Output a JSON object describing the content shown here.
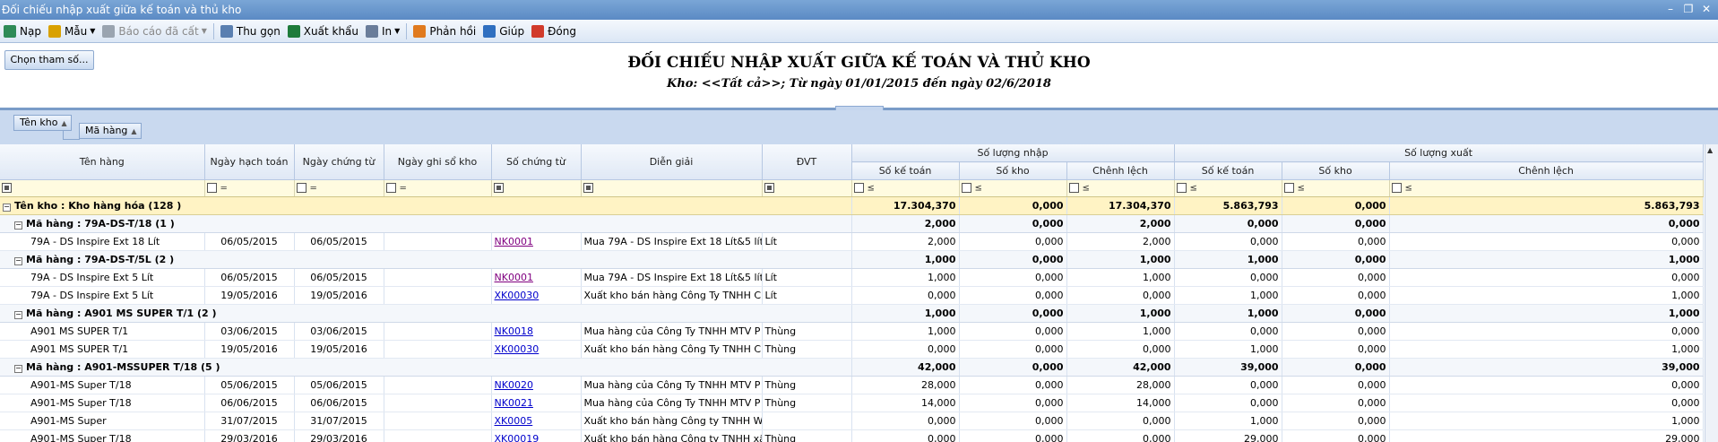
{
  "window": {
    "title": "Đối chiếu nhập xuất giữa kế toán và thủ kho"
  },
  "toolbar": {
    "items": [
      {
        "label": "Nạp",
        "icon": "refresh-icon",
        "color": "#2e8b57"
      },
      {
        "label": "Mẫu",
        "icon": "template-icon",
        "color": "#d9a100",
        "dropdown": true
      },
      {
        "label": "Báo cáo đã cất",
        "icon": "save-icon",
        "color": "#9aa4b0",
        "dropdown": true,
        "disabled": true
      },
      {
        "label": "Thu gọn",
        "icon": "collapse-icon",
        "color": "#5a7fb0"
      },
      {
        "label": "Xuất khẩu",
        "icon": "excel-icon",
        "color": "#1e7b3a"
      },
      {
        "label": "In",
        "icon": "printer-icon",
        "color": "#6a7d9a",
        "dropdown": true
      },
      {
        "label": "Phản hồi",
        "icon": "mail-icon",
        "color": "#e07a1e"
      },
      {
        "label": "Giúp",
        "icon": "help-icon",
        "color": "#2f6fc0"
      },
      {
        "label": "Đóng",
        "icon": "close-icon",
        "color": "#d13b2b"
      }
    ]
  },
  "params": {
    "button_label": "Chọn tham số..."
  },
  "report": {
    "title": "ĐỐI CHIẾU NHẬP XUẤT GIỮA KẾ TOÁN VÀ THỦ KHO",
    "subtitle": "Kho: <<Tất cả>>; Từ ngày 01/01/2015 đến ngày 02/6/2018"
  },
  "grouping": {
    "level1": "Tên kho",
    "level2": "Mã hàng"
  },
  "columns": {
    "ten_hang": "Tên hàng",
    "ngay_hach_toan": "Ngày hạch toán",
    "ngay_chung_tu": "Ngày chứng từ",
    "ngay_ghi_so_kho": "Ngày ghi sổ kho",
    "so_chung_tu": "Số chứng từ",
    "dien_giai": "Diễn giải",
    "dvt": "ĐVT",
    "nhap_band": "Số lượng nhập",
    "xuat_band": "Số lượng xuất",
    "so_ke_toan": "Số kế toán",
    "so_kho": "Số kho",
    "chenh_lech": "Chênh lệch"
  },
  "filter": {
    "eq": "=",
    "le": "≤"
  },
  "group_warehouse": {
    "label": "Tên kho : Kho hàng hóa (128 )",
    "nhap_kt": "17.304,370",
    "nhap_kho": "0,000",
    "nhap_cl": "17.304,370",
    "xuat_kt": "5.863,793",
    "xuat_kho": "0,000",
    "xuat_cl": "5.863,793"
  },
  "groups": [
    {
      "label": "Mã hàng : 79A-DS-T/18 (1 )",
      "nhap_kt": "2,000",
      "nhap_kho": "0,000",
      "nhap_cl": "2,000",
      "xuat_kt": "0,000",
      "xuat_kho": "0,000",
      "xuat_cl": "0,000",
      "rows": [
        {
          "ten": "79A - DS Inspire Ext 18 Lít",
          "nht": "06/05/2015",
          "nct": "06/05/2015",
          "ngsk": "",
          "sct": "NK0001",
          "visited": true,
          "dg": "Mua 79A - DS Inspire Ext 18 Lít&5 lít,",
          "dvt": "Lít",
          "nkt": "2,000",
          "nkho": "0,000",
          "ncl": "2,000",
          "xkt": "0,000",
          "xkho": "0,000",
          "xcl": "0,000"
        }
      ]
    },
    {
      "label": "Mã hàng : 79A-DS-T/5L (2 )",
      "nhap_kt": "1,000",
      "nhap_kho": "0,000",
      "nhap_cl": "1,000",
      "xuat_kt": "1,000",
      "xuat_kho": "0,000",
      "xuat_cl": "1,000",
      "rows": [
        {
          "ten": "79A - DS Inspire Ext 5 Lít",
          "nht": "06/05/2015",
          "nct": "06/05/2015",
          "ngsk": "",
          "sct": "NK0001",
          "visited": true,
          "dg": "Mua 79A - DS Inspire Ext 18 Lít&5 lít,",
          "dvt": "Lít",
          "nkt": "1,000",
          "nkho": "0,000",
          "ncl": "1,000",
          "xkt": "0,000",
          "xkho": "0,000",
          "xcl": "0,000"
        },
        {
          "ten": "79A - DS Inspire Ext 5 Lít",
          "nht": "19/05/2016",
          "nct": "19/05/2016",
          "ngsk": "",
          "sct": "XK00030",
          "visited": false,
          "dg": "Xuất kho bán hàng Công Ty TNHH C",
          "dvt": "Lít",
          "nkt": "0,000",
          "nkho": "0,000",
          "ncl": "0,000",
          "xkt": "1,000",
          "xkho": "0,000",
          "xcl": "1,000"
        }
      ]
    },
    {
      "label": "Mã hàng : A901 MS SUPER T/1 (2 )",
      "nhap_kt": "1,000",
      "nhap_kho": "0,000",
      "nhap_cl": "1,000",
      "xuat_kt": "1,000",
      "xuat_kho": "0,000",
      "xuat_cl": "1,000",
      "rows": [
        {
          "ten": "A901 MS SUPER T/1",
          "nht": "03/06/2015",
          "nct": "03/06/2015",
          "ngsk": "",
          "sct": "NK0018",
          "visited": false,
          "dg": "Mua hàng của Công Ty TNHH MTV P",
          "dvt": "Thùng",
          "nkt": "1,000",
          "nkho": "0,000",
          "ncl": "1,000",
          "xkt": "0,000",
          "xkho": "0,000",
          "xcl": "0,000"
        },
        {
          "ten": "A901 MS SUPER T/1",
          "nht": "19/05/2016",
          "nct": "19/05/2016",
          "ngsk": "",
          "sct": "XK00030",
          "visited": false,
          "dg": "Xuất kho bán hàng Công Ty TNHH C",
          "dvt": "Thùng",
          "nkt": "0,000",
          "nkho": "0,000",
          "ncl": "0,000",
          "xkt": "1,000",
          "xkho": "0,000",
          "xcl": "1,000"
        }
      ]
    },
    {
      "label": "Mã hàng : A901-MSSUPER T/18 (5 )",
      "nhap_kt": "42,000",
      "nhap_kho": "0,000",
      "nhap_cl": "42,000",
      "xuat_kt": "39,000",
      "xuat_kho": "0,000",
      "xuat_cl": "39,000",
      "rows": [
        {
          "ten": "A901-MS Super T/18",
          "nht": "05/06/2015",
          "nct": "05/06/2015",
          "ngsk": "",
          "sct": "NK0020",
          "visited": false,
          "dg": "Mua hàng của Công Ty TNHH MTV P",
          "dvt": "Thùng",
          "nkt": "28,000",
          "nkho": "0,000",
          "ncl": "28,000",
          "xkt": "0,000",
          "xkho": "0,000",
          "xcl": "0,000"
        },
        {
          "ten": "A901-MS Super T/18",
          "nht": "06/06/2015",
          "nct": "06/06/2015",
          "ngsk": "",
          "sct": "NK0021",
          "visited": false,
          "dg": "Mua hàng của Công Ty TNHH MTV P",
          "dvt": "Thùng",
          "nkt": "14,000",
          "nkho": "0,000",
          "ncl": "14,000",
          "xkt": "0,000",
          "xkho": "0,000",
          "xcl": "0,000"
        },
        {
          "ten": "A901-MS Super",
          "nht": "31/07/2015",
          "nct": "31/07/2015",
          "ngsk": "",
          "sct": "XK0005",
          "visited": false,
          "dg": "Xuất kho bán hàng Công ty TNHH Wo",
          "dvt": "",
          "nkt": "0,000",
          "nkho": "0,000",
          "ncl": "0,000",
          "xkt": "1,000",
          "xkho": "0,000",
          "xcl": "1,000"
        },
        {
          "ten": "A901-MS Super T/18",
          "nht": "29/03/2016",
          "nct": "29/03/2016",
          "ngsk": "",
          "sct": "XK00019",
          "visited": false,
          "dg": "Xuất kho bán hàng Công ty TNHH xă",
          "dvt": "Thùng",
          "nkt": "0,000",
          "nkho": "0,000",
          "ncl": "0,000",
          "xkt": "29,000",
          "xkho": "0,000",
          "xcl": "29,000"
        }
      ]
    }
  ]
}
